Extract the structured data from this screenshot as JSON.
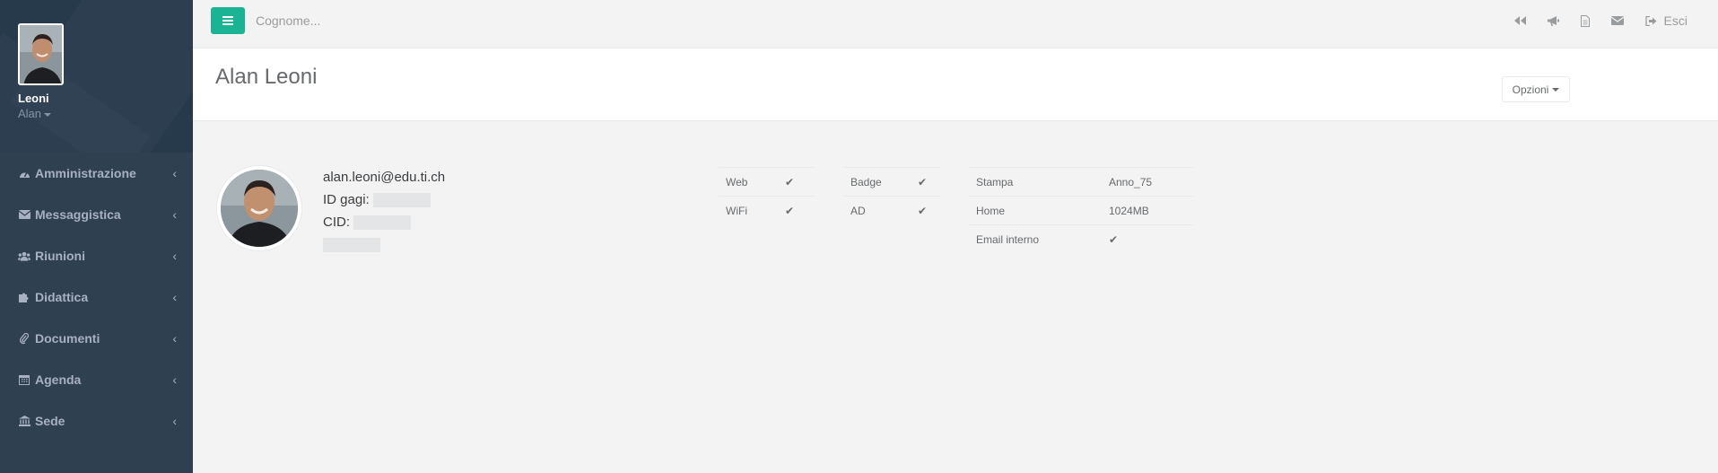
{
  "sidebar": {
    "profile": {
      "last_name": "Leoni",
      "first_name": "Alan"
    },
    "items": [
      {
        "label": "Amministrazione",
        "icon": "dashboard-icon"
      },
      {
        "label": "Messaggistica",
        "icon": "envelope-icon"
      },
      {
        "label": "Riunioni",
        "icon": "users-icon"
      },
      {
        "label": "Didattica",
        "icon": "puzzle-icon"
      },
      {
        "label": "Documenti",
        "icon": "paperclip-icon"
      },
      {
        "label": "Agenda",
        "icon": "calendar-icon"
      },
      {
        "label": "Sede",
        "icon": "bank-icon"
      }
    ],
    "chevron": "‹"
  },
  "topbar": {
    "search_placeholder": "Cognome...",
    "icons": [
      "backward-icon",
      "bullhorn-icon",
      "file-icon",
      "envelope-icon"
    ],
    "logout_label": "Esci"
  },
  "heading": {
    "title": "Alan Leoni",
    "options_label": "Opzioni"
  },
  "user": {
    "email": "alan.leoni@edu.ti.ch",
    "id_label": "ID gagi:",
    "cid_label": "CID:"
  },
  "tables": {
    "t1": [
      {
        "label": "Web",
        "check": "✔"
      },
      {
        "label": "WiFi",
        "check": "✔"
      }
    ],
    "t2": [
      {
        "label": "Badge",
        "check": "✔"
      },
      {
        "label": "AD",
        "check": "✔"
      }
    ],
    "t3": [
      {
        "label": "Stampa",
        "value": "Anno_75"
      },
      {
        "label": "Home",
        "value": "1024MB"
      },
      {
        "label": "Email interno",
        "value": "✔"
      }
    ]
  },
  "colors": {
    "sidebar_bg": "#2f4050",
    "accent": "#1ab394",
    "page_bg": "#f3f3f4"
  }
}
